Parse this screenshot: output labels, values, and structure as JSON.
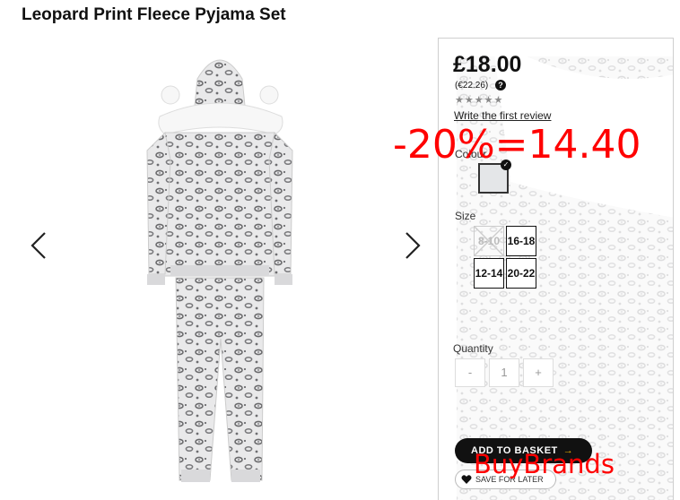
{
  "product": {
    "title": "Leopard Print Fleece Pyjama Set",
    "price": "£18.00",
    "price_alt": "(€22.26)",
    "help_label": "?",
    "rating_stars": "★★★★★",
    "review_link": "Write the first review",
    "colour_label": "Colour",
    "size_label": "Size",
    "sizes": [
      {
        "label": "8-10",
        "available": false
      },
      {
        "label": "16-18",
        "available": true
      },
      {
        "label": "12-14",
        "available": true
      },
      {
        "label": "20-22",
        "available": true
      }
    ],
    "quantity_label": "Quantity",
    "quantity": {
      "minus": "-",
      "value": "1",
      "plus": "+"
    },
    "add_to_basket": "ADD TO BASKET",
    "add_to_basket_arrow": "→",
    "save_for_later": "SAVE FOR LATER",
    "check_mark": "✓"
  },
  "overlays": {
    "promo_text": "-20%=14.40",
    "watermark_text": "BuyBrands"
  },
  "colors": {
    "accent_red": "#ff0000",
    "button_dark": "#111111",
    "arrow_accent": "#f0b400"
  },
  "icons": {
    "prev": "chevron-left-icon",
    "next": "chevron-right-icon",
    "help": "question-circle-icon",
    "heart": "heart-icon",
    "check": "check-icon"
  }
}
